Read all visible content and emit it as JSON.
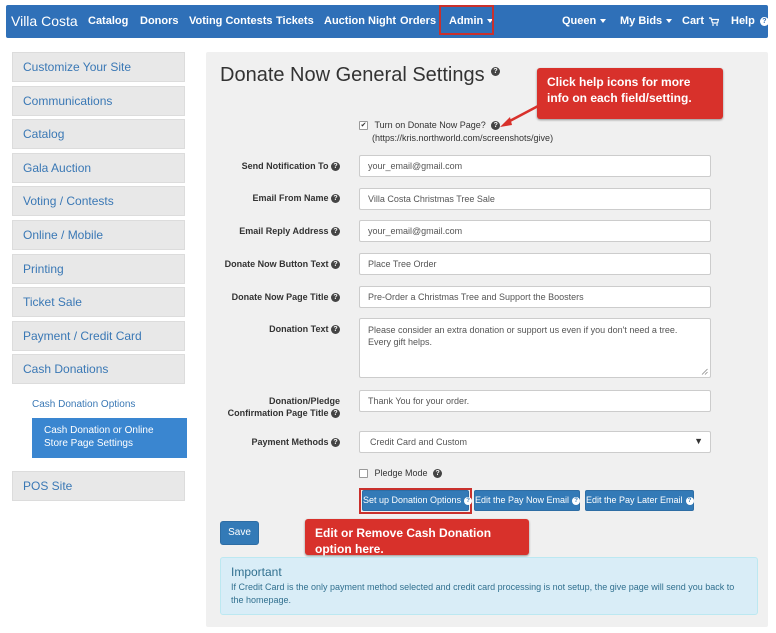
{
  "navbar": {
    "brand": "Villa Costa",
    "items": [
      "Catalog",
      "Donors",
      "Voting Contests",
      "Tickets",
      "Auction Night",
      "Orders"
    ],
    "admin": "Admin",
    "right": {
      "queen": "Queen",
      "mybids": "My Bids",
      "cart": "Cart",
      "help": "Help"
    },
    "icons": {
      "cart": "shopping-cart-icon",
      "help": "question-circle-icon"
    }
  },
  "sidebar": {
    "items": [
      "Customize Your Site",
      "Communications",
      "Catalog",
      "Gala Auction",
      "Voting / Contests",
      "Online / Mobile",
      "Printing",
      "Ticket Sale",
      "Payment / Credit Card",
      "Cash Donations"
    ],
    "sub": {
      "link": "Cash Donation Options",
      "active": "Cash Donation or Online Store Page Settings"
    },
    "last": "POS Site"
  },
  "main": {
    "title": "Donate Now General Settings",
    "callout_top": "Click help icons for more info on each field/setting.",
    "callout_bottom": "Edit or Remove Cash Donation option here.",
    "turn_on": {
      "label": "Turn on Donate Now Page?",
      "url": "(https://kris.northworld.com/screenshots/give)",
      "checked": true
    },
    "fields": {
      "send_notification": {
        "label": "Send Notification To",
        "value": "your_email@gmail.com"
      },
      "email_from_name": {
        "label": "Email From Name",
        "value": "Villa Costa Christmas Tree Sale"
      },
      "email_reply": {
        "label": "Email Reply Address",
        "value": "your_email@gmail.com"
      },
      "donate_button_text": {
        "label": "Donate Now Button Text",
        "value": "Place Tree Order"
      },
      "donate_page_title": {
        "label": "Donate Now Page Title",
        "value": "Pre-Order a Christmas Tree and Support the Boosters"
      },
      "donation_text": {
        "label": "Donation Text",
        "value": "Please consider an extra donation or support us even if you don't need a tree. Every gift helps."
      },
      "confirmation_title": {
        "label_line1": "Donation/Pledge",
        "label_line2": "Confirmation Page Title",
        "value": "Thank You for your order."
      },
      "payment_methods": {
        "label": "Payment Methods",
        "value": "Credit Card and Custom"
      }
    },
    "pledge_mode": "Pledge Mode",
    "buttons": {
      "setup_options": "Set up Donation Options",
      "edit_pay_now": "Edit the Pay Now Email",
      "edit_pay_later": "Edit the Pay Later Email"
    },
    "save": "Save",
    "alert": {
      "title": "Important",
      "body": "If Credit Card is the only payment method selected and credit card processing is not setup, the give page will send you back to the homepage."
    }
  },
  "colors": {
    "navbar": "#2f70b8",
    "primary": "#337ab7",
    "callout": "#d8312b",
    "alert_bg": "#d9edf7"
  }
}
